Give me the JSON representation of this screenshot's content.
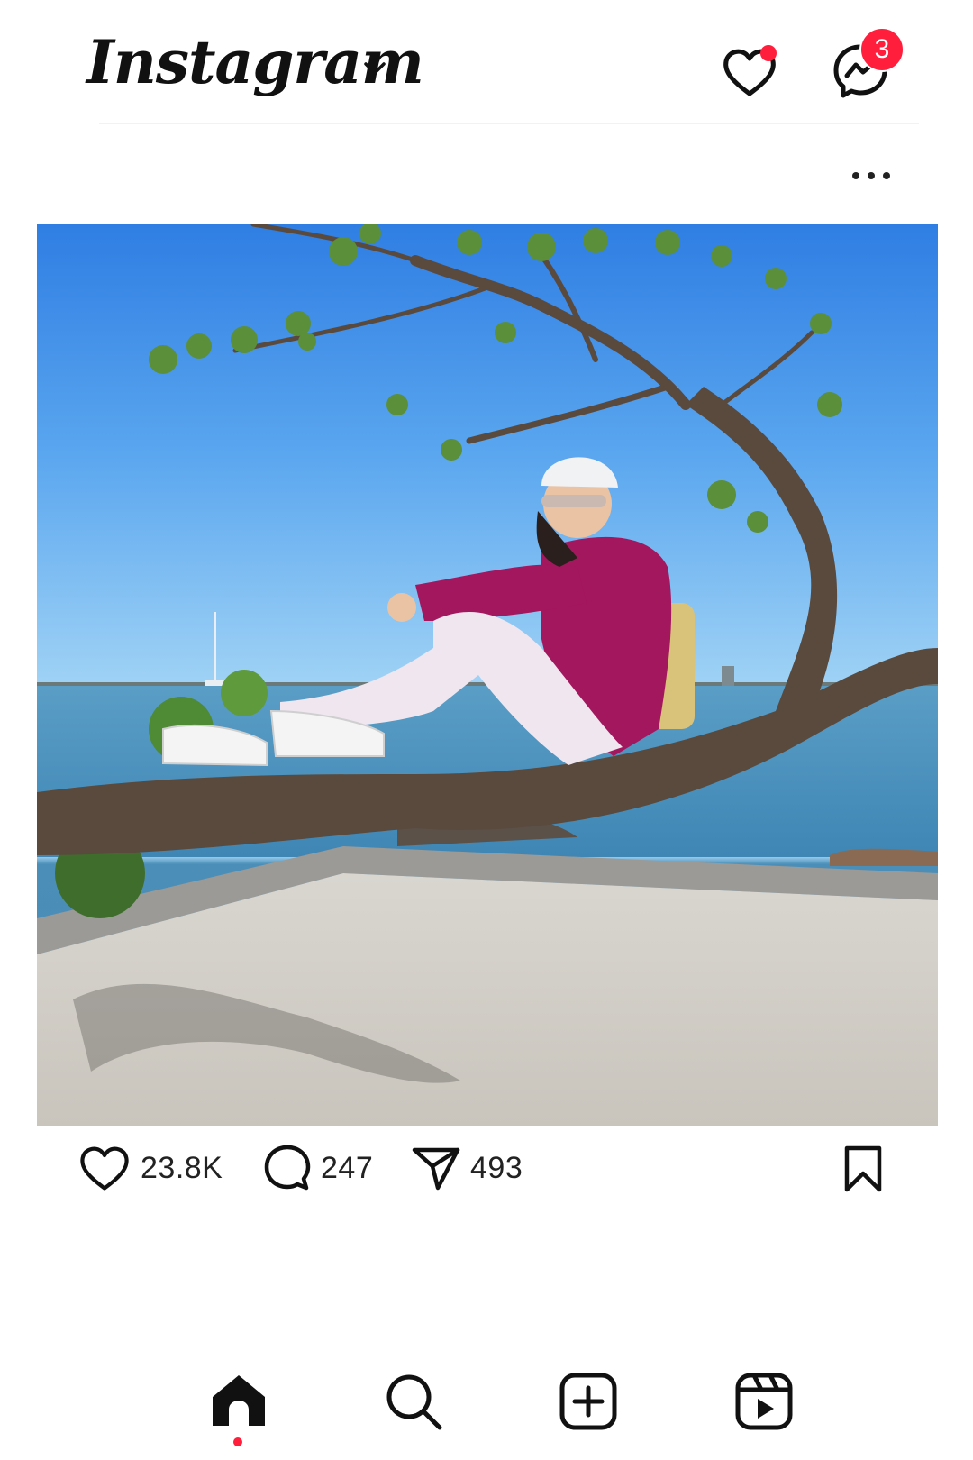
{
  "app": {
    "title": "Instagram",
    "accent_color": "#ff1f3d"
  },
  "header": {
    "logo_text": "Instagram",
    "account_switcher_icon": "chevron-down-icon",
    "notifications_icon": "heart-icon",
    "notifications_has_dot": true,
    "messages_icon": "messenger-icon",
    "messages_badge": "3"
  },
  "post": {
    "options_icon": "more-horizontal-icon",
    "image_icon": "photo",
    "actions": {
      "like_icon": "heart-outline-icon",
      "likes": "23.8K",
      "comment_icon": "comment-icon",
      "comments": "247",
      "share_icon": "paper-plane-icon",
      "shares": "493",
      "save_icon": "bookmark-icon"
    }
  },
  "bottom_nav": {
    "items": [
      {
        "icon": "home-icon",
        "active": true
      },
      {
        "icon": "search-icon",
        "active": false
      },
      {
        "icon": "create-post-icon",
        "active": false
      },
      {
        "icon": "reels-icon",
        "active": false
      }
    ]
  }
}
